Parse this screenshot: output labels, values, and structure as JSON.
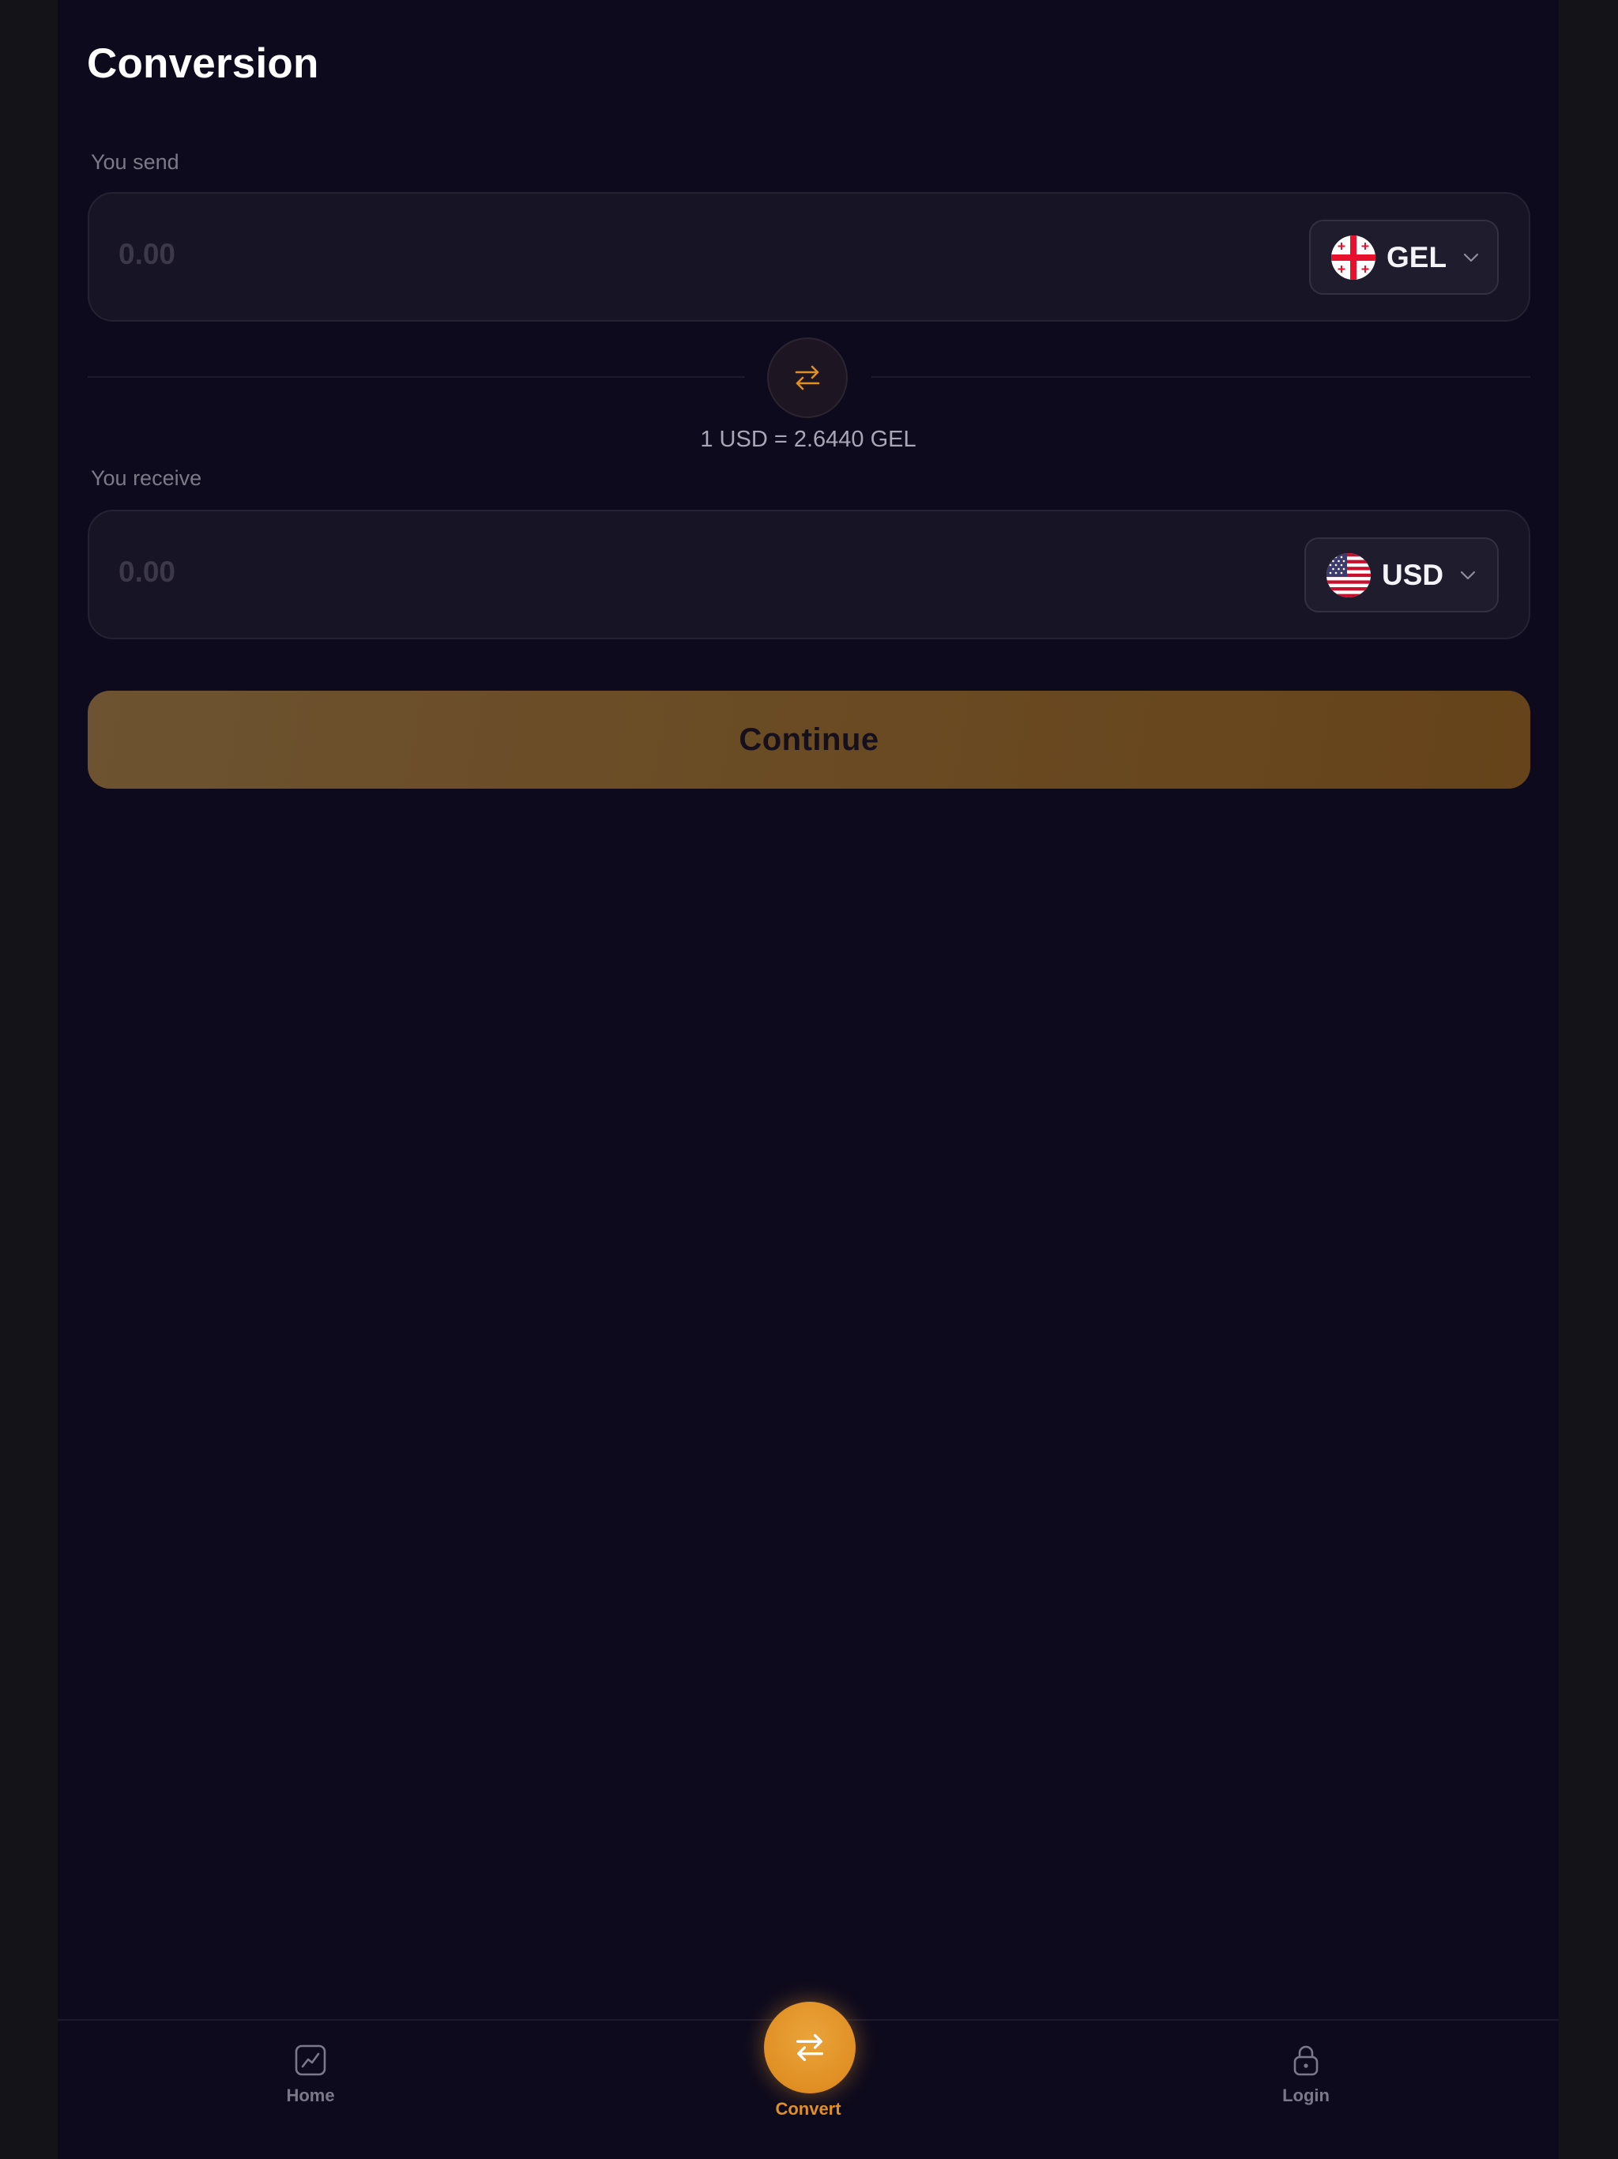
{
  "page": {
    "title": "Conversion"
  },
  "send": {
    "label": "You send",
    "amount": "0.00",
    "currency": "GEL",
    "flag_icon": "georgia-flag-icon"
  },
  "swap": {
    "icon": "swap-arrows-icon",
    "rate": "1 USD = 2.6440 GEL"
  },
  "receive": {
    "label": "You receive",
    "amount": "0.00",
    "currency": "USD",
    "flag_icon": "usa-flag-icon"
  },
  "continue_label": "Continue",
  "nav": {
    "home_label": "Home",
    "convert_label": "Convert",
    "login_label": "Login"
  },
  "colors": {
    "background": "#0d0a1d",
    "accent": "#e08f24",
    "card": "#171425"
  }
}
